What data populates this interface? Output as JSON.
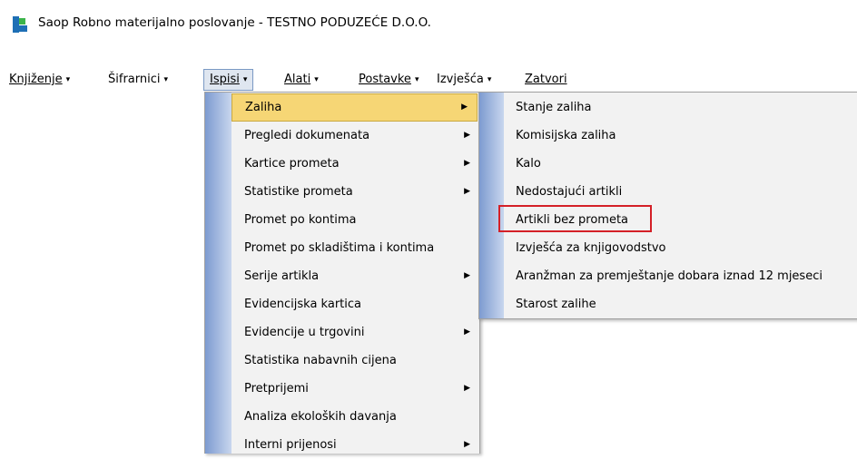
{
  "window": {
    "title": "Saop  Robno materijalno poslovanje - TESTNO PODUZEĆE D.O.O.",
    "logo_icon": "saop-logo-icon",
    "logo_colors": [
      "#1e6fb5",
      "#3cb44a"
    ]
  },
  "menubar": {
    "items": [
      {
        "label": "Knjiženje",
        "arrow": "▾"
      },
      {
        "label": "Šifrarnici",
        "arrow": "▾"
      },
      {
        "label": "Ispisi",
        "arrow": "▾"
      },
      {
        "label": "Alati",
        "arrow": "▾"
      },
      {
        "label": "Postavke",
        "arrow": "▾"
      },
      {
        "label": "Izvješća",
        "arrow": "▾"
      },
      {
        "label": "Zatvori",
        "arrow": ""
      }
    ],
    "open_item": "Ispisi"
  },
  "ispisi_menu": {
    "items": [
      {
        "label": "Zaliha",
        "submenu": true
      },
      {
        "label": "Pregledi dokumenata",
        "submenu": true
      },
      {
        "label": "Kartice prometa",
        "submenu": true
      },
      {
        "label": "Statistike prometa",
        "submenu": true
      },
      {
        "label": "Promet po kontima",
        "submenu": false
      },
      {
        "label": "Promet po skladištima i kontima",
        "submenu": false
      },
      {
        "label": "Serije artikla",
        "submenu": true
      },
      {
        "label": "Evidencijska kartica",
        "submenu": false
      },
      {
        "label": "Evidencije u trgovini",
        "submenu": true
      },
      {
        "label": "Statistika nabavnih cijena",
        "submenu": false
      },
      {
        "label": "Pretprijemi",
        "submenu": true
      },
      {
        "label": "Analiza ekoloških davanja",
        "submenu": false
      },
      {
        "label": "Interni prijenosi",
        "submenu": true
      }
    ],
    "highlighted": "Zaliha",
    "submenu_arrow": "▶"
  },
  "zaliha_menu": {
    "items": [
      {
        "label": "Stanje zaliha"
      },
      {
        "label": "Komisijska zaliha"
      },
      {
        "label": "Kalo"
      },
      {
        "label": "Nedostajući artikli"
      },
      {
        "label": "Artikli bez prometa"
      },
      {
        "label": "Izvješća za knjigovodstvo"
      },
      {
        "label": "Aranžman za premještanje dobara iznad 12 mjeseci"
      },
      {
        "label": "Starost zalihe"
      }
    ],
    "outlined_item": "Artikli bez prometa",
    "outline_color": "#d42027"
  },
  "colors": {
    "highlight_fill": "#f6d675",
    "gutter": "#7d9bd0",
    "menu_bg": "#f2f2f2"
  }
}
